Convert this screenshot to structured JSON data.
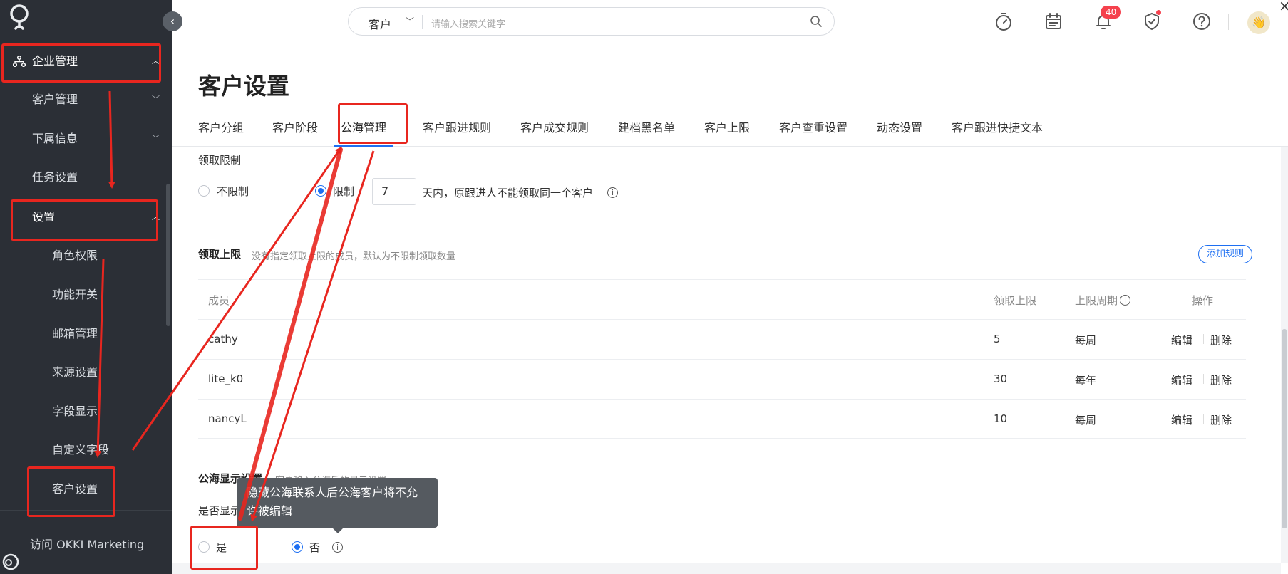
{
  "sidebar": {
    "group_enterprise": "企业管理",
    "item_customer_mgmt": "客户管理",
    "item_sub_info": "下属信息",
    "item_task_settings": "任务设置",
    "group_settings": "设置",
    "sub_items": [
      "角色权限",
      "功能开关",
      "邮箱管理",
      "来源设置",
      "字段显示",
      "自定义字段",
      "客户设置"
    ],
    "footer_link": "访问 OKKI Marketing"
  },
  "topbar": {
    "search_scope": "客户",
    "search_placeholder": "请输入搜索关键字",
    "notification_count": "40"
  },
  "page": {
    "title": "客户设置",
    "tabs": [
      "客户分组",
      "客户阶段",
      "公海管理",
      "客户跟进规则",
      "客户成交规则",
      "建档黑名单",
      "客户上限",
      "客户查重设置",
      "动态设置",
      "客户跟进快捷文本"
    ],
    "active_tab": "公海管理"
  },
  "claim_limit": {
    "title": "领取限制",
    "option_unlimited": "不限制",
    "option_limited": "限制",
    "days_value": "7",
    "days_suffix": "天内，原跟进人不能领取同一个客户",
    "selected": "限制"
  },
  "claim_cap": {
    "title": "领取上限",
    "desc": "没有指定领取上限的成员，默认为不限制领取数量",
    "add_rule": "添加规则",
    "columns": [
      "成员",
      "领取上限",
      "上限周期",
      "操作"
    ],
    "rows": [
      {
        "member": "cathy",
        "cap": "5",
        "period": "每周",
        "edit": "编辑",
        "delete": "删除"
      },
      {
        "member": "lite_k0",
        "cap": "30",
        "period": "每年",
        "edit": "编辑",
        "delete": "删除"
      },
      {
        "member": "nancyL",
        "cap": "10",
        "period": "每周",
        "edit": "编辑",
        "delete": "删除"
      }
    ]
  },
  "pool_display": {
    "title": "公海显示设置",
    "desc": "客户移入公海后的显示设置",
    "question": "是否显示公海联系人",
    "option_yes": "是",
    "option_no": "否",
    "selected": "否",
    "tooltip": "隐藏公海联系人后公海客户将不允许被编辑"
  },
  "colors": {
    "sidebar_bg": "#2b2f36",
    "accent": "#1d6ff2",
    "annotation_red": "#e8261f",
    "badge_red": "#f5414d"
  }
}
